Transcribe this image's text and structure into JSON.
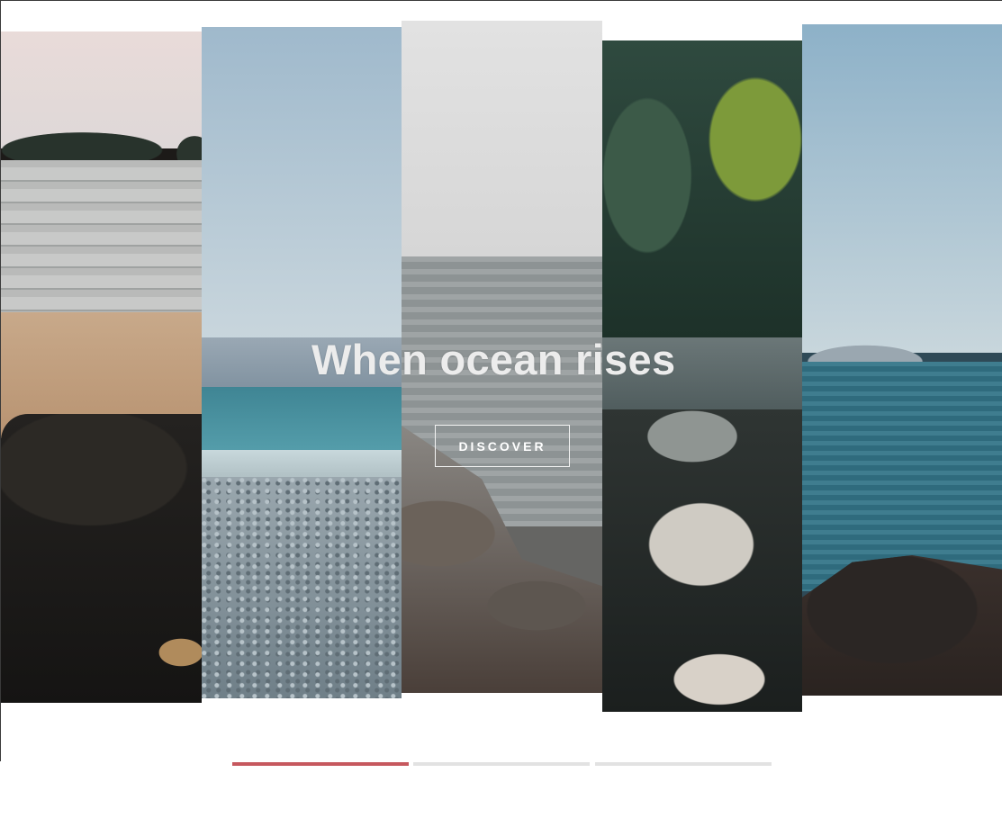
{
  "hero": {
    "title": "When ocean rises",
    "button_label": "DISCOVER"
  },
  "slider": {
    "slide_count": 3,
    "active_index": 0
  },
  "colors": {
    "indicator_active": "#c6585e",
    "indicator_inactive": "#e2e2e2",
    "frame_border": "#3a3a3a"
  }
}
